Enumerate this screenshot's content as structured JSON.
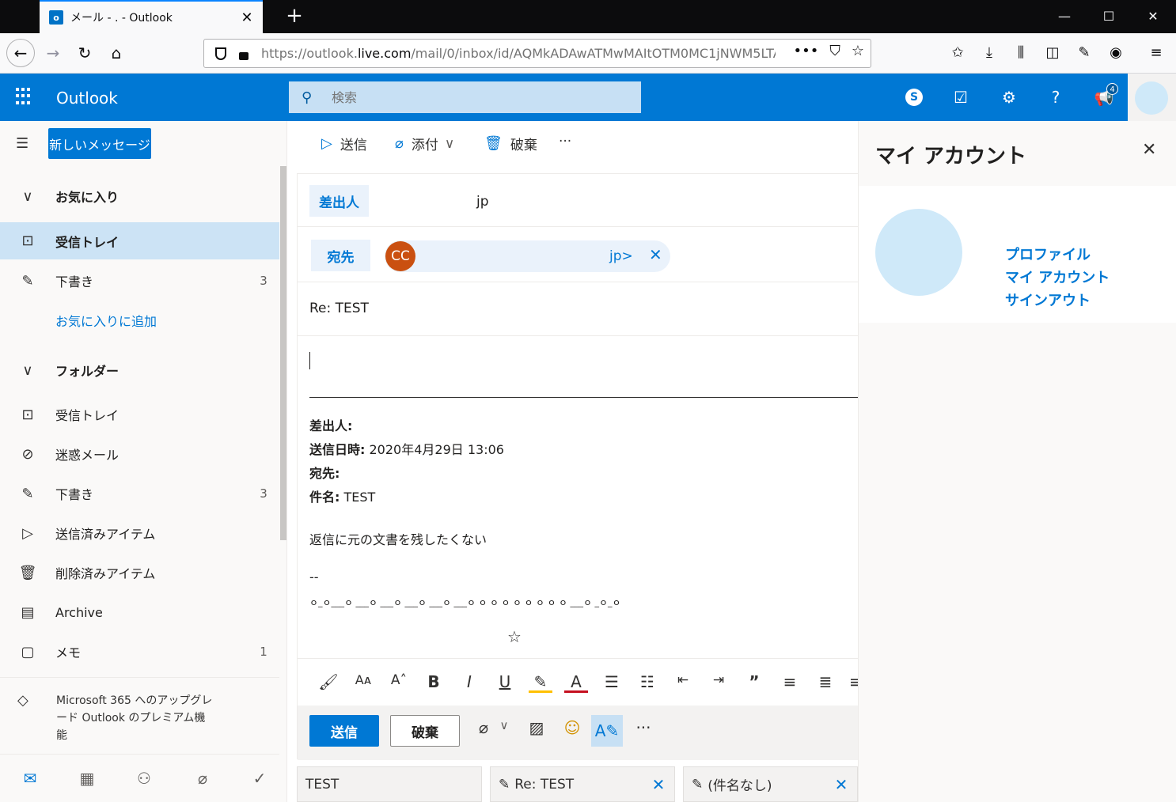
{
  "browser": {
    "tab_title": "メール - .                  - Outlook",
    "favicon_letter": "o",
    "url_prefix": "https://outlook.",
    "url_host": "live.com",
    "url_suffix": "/mail/0/inbox/id/AQMkADAwATMwMAItOTM0MC1jNWM5LTA",
    "new_tab_glyph": "+"
  },
  "header": {
    "brand": "Outlook",
    "search_placeholder": "検索",
    "notification_count": "4"
  },
  "leftnav": {
    "new_message": "新しいメッセージ",
    "favorites_header": "お気に入り",
    "favorites": [
      {
        "label": "受信トレイ",
        "count": ""
      },
      {
        "label": "下書き",
        "count": "3"
      }
    ],
    "add_favorite": "お気に入りに追加",
    "folders_header": "フォルダー",
    "folders": [
      {
        "label": "受信トレイ",
        "count": ""
      },
      {
        "label": "迷惑メール",
        "count": ""
      },
      {
        "label": "下書き",
        "count": "3"
      },
      {
        "label": "送信済みアイテム",
        "count": ""
      },
      {
        "label": "削除済みアイテム",
        "count": ""
      },
      {
        "label": "Archive",
        "count": ""
      },
      {
        "label": "メモ",
        "count": "1"
      }
    ],
    "upsell": "Microsoft 365 へのアップグレード Outlook のプレミアム機能"
  },
  "compose_toolbar": {
    "send": "送信",
    "attach": "添付",
    "discard": "破棄",
    "more": "···"
  },
  "compose": {
    "from_label": "差出人",
    "from_value": "jp",
    "to_label": "宛先",
    "recipient_initials": "CC",
    "recipient_text": "jp>",
    "subject": "Re: TEST",
    "quote": {
      "from_label": "差出人:",
      "sent_label": "送信日時:",
      "sent_value": " 2020年4月29日 13:06",
      "to_label": "宛先:",
      "subject_label": "件名:",
      "subject_value": " TEST",
      "body": "返信に元の文書を残したくない",
      "sig_dash": "--",
      "sig_line": "ｏ_ｏ___ｏ ___ｏ ___ｏ ___ｏ ___ｏ ___ｏ ｏ ｏ ｏ ｏ ｏ ｏ ｏ ｏ ___ｏ _ｏ_ｏ",
      "sig_star": "☆"
    },
    "send_button": "送信",
    "discard_button": "破棄"
  },
  "draft_tabs": [
    {
      "label": "TEST"
    },
    {
      "label": "Re: TEST"
    },
    {
      "label": "(件名なし)"
    }
  ],
  "account": {
    "title": "マイ アカウント",
    "links": [
      "プロファイル",
      "マイ アカウント",
      "サインアウト"
    ]
  },
  "colors": {
    "brand_blue": "#0078d4",
    "recipient_avatar": "#ca5010"
  }
}
